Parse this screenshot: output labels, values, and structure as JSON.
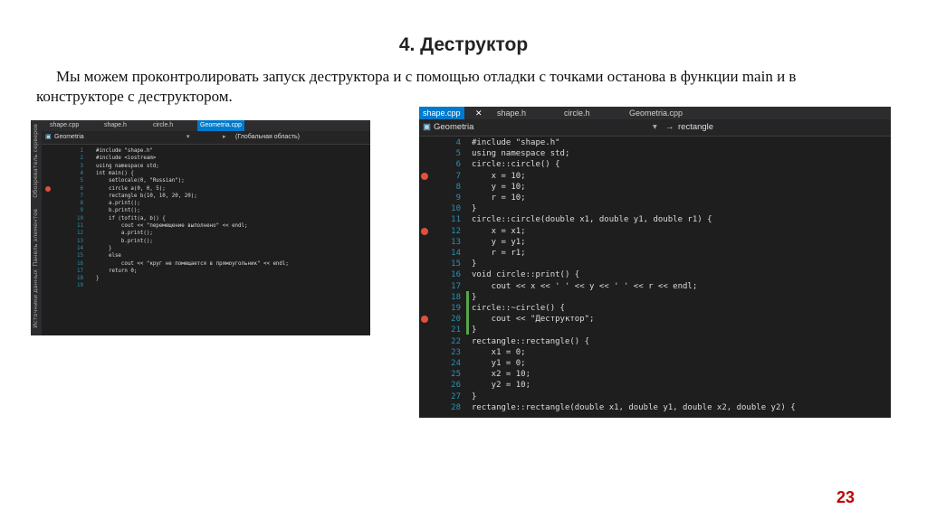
{
  "slide": {
    "title": "4. Деструктор",
    "paragraph_line1": "Мы можем проконтролировать запуск деструктора и с помощью отладки с точками останова в функции main и в",
    "paragraph_line2": "конструкторе с деструктором.",
    "page_number": "23"
  },
  "ide_left": {
    "side_panels": [
      "Обозреватель серверов",
      "Панель элементов",
      "Источники данных"
    ],
    "tabs": [
      "shape.cpp",
      "shape.h",
      "circle.h",
      "Geometria.cpp"
    ],
    "active_tab": "Geometria.cpp",
    "nav_project": "Geometria",
    "nav_scope": "(Глобальная область)",
    "lines": [
      {
        "n": "1",
        "t": "#include \"shape.h\""
      },
      {
        "n": "2",
        "t": "#include <iostream>"
      },
      {
        "n": "3",
        "t": "using namespace std;"
      },
      {
        "n": "4",
        "t": "int main() {"
      },
      {
        "n": "5",
        "t": "    setlocale(0, \"Russian\");"
      },
      {
        "n": "6",
        "t": "    circle a(0, 0, 5);"
      },
      {
        "n": "7",
        "t": "    rectangle b(10, 10, 20, 20);"
      },
      {
        "n": "8",
        "t": "    a.print();"
      },
      {
        "n": "9",
        "t": "    b.print();"
      },
      {
        "n": "10",
        "t": "    if (tofit(a, b)) {"
      },
      {
        "n": "11",
        "t": "        cout << \"перемещение выполнено\" << endl;"
      },
      {
        "n": "12",
        "t": "        a.print();"
      },
      {
        "n": "13",
        "t": "        b.print();"
      },
      {
        "n": "14",
        "t": "    }"
      },
      {
        "n": "15",
        "t": "    else"
      },
      {
        "n": "16",
        "t": "        cout << \"круг не помещается в прямоугольник\" << endl;"
      },
      {
        "n": "17",
        "t": "    return 0;"
      },
      {
        "n": "18",
        "t": "}"
      },
      {
        "n": "19",
        "t": ""
      }
    ],
    "breakpoint_lines": [
      "6"
    ]
  },
  "ide_right": {
    "tabs": [
      "shape.cpp",
      "shape.h",
      "circle.h",
      "Geometria.cpp"
    ],
    "active_tab": "shape.cpp",
    "nav_project": "Geometria",
    "nav_member": "rectangle",
    "lines": [
      {
        "n": "4",
        "t": "#include \"shape.h\""
      },
      {
        "n": "5",
        "t": "using namespace std;"
      },
      {
        "n": "6",
        "t": "circle::circle() {"
      },
      {
        "n": "7",
        "t": "    x = 10;"
      },
      {
        "n": "8",
        "t": "    y = 10;"
      },
      {
        "n": "9",
        "t": "    r = 10;"
      },
      {
        "n": "10",
        "t": "}"
      },
      {
        "n": "11",
        "t": "circle::circle(double x1, double y1, double r1) {"
      },
      {
        "n": "12",
        "t": "    x = x1;"
      },
      {
        "n": "13",
        "t": "    y = y1;"
      },
      {
        "n": "14",
        "t": "    r = r1;"
      },
      {
        "n": "15",
        "t": "}"
      },
      {
        "n": "16",
        "t": "void circle::print() {"
      },
      {
        "n": "17",
        "t": "    cout << x << ' ' << y << ' ' << r << endl;"
      },
      {
        "n": "18",
        "t": "}"
      },
      {
        "n": "19",
        "t": "circle::~circle() {"
      },
      {
        "n": "20",
        "t": "    cout << \"Деструктор\";"
      },
      {
        "n": "21",
        "t": "}"
      },
      {
        "n": "22",
        "t": "rectangle::rectangle() {"
      },
      {
        "n": "23",
        "t": "    x1 = 0;"
      },
      {
        "n": "24",
        "t": "    y1 = 0;"
      },
      {
        "n": "25",
        "t": "    x2 = 10;"
      },
      {
        "n": "26",
        "t": "    y2 = 10;"
      },
      {
        "n": "27",
        "t": "}"
      },
      {
        "n": "28",
        "t": "rectangle::rectangle(double x1, double y1, double x2, double y2) {"
      }
    ],
    "breakpoint_lines": [
      "7",
      "12",
      "20"
    ]
  },
  "colors": {
    "breakpoint": "#e0503c",
    "active_tab": "#007acc",
    "line_number": "#2b91af",
    "editor_bg": "#1e1e1e",
    "page_number": "#c00000"
  }
}
